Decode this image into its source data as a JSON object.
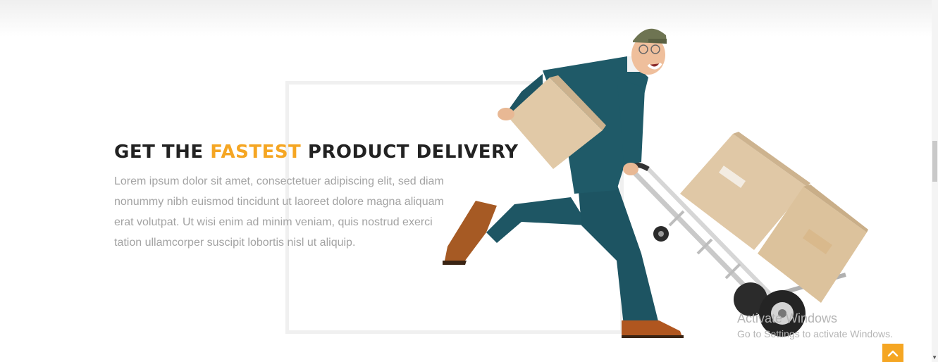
{
  "hero": {
    "heading_pre": "GET THE ",
    "heading_accent": "FASTEST",
    "heading_post": " PRODUCT DELIVERY",
    "body": "Lorem ipsum dolor sit amet, consectetuer adipiscing elit, sed diam nonummy nibh euismod tincidunt ut laoreet dolore magna aliquam erat volutpat. Ut wisi enim ad minim veniam, quis nostrud exerci tation ullamcorper suscipit lobortis nisl ut aliquip."
  },
  "watermark": {
    "line1": "Activate Windows",
    "line2": "Go to Settings to activate Windows."
  },
  "colors": {
    "accent": "#f5a623",
    "heading": "#222222",
    "body_text": "#a3a3a3",
    "frame_border": "#f0f0f0"
  },
  "icons": {
    "back_to_top": "chevron-up-icon",
    "illustration": "delivery-man-with-hand-truck"
  }
}
